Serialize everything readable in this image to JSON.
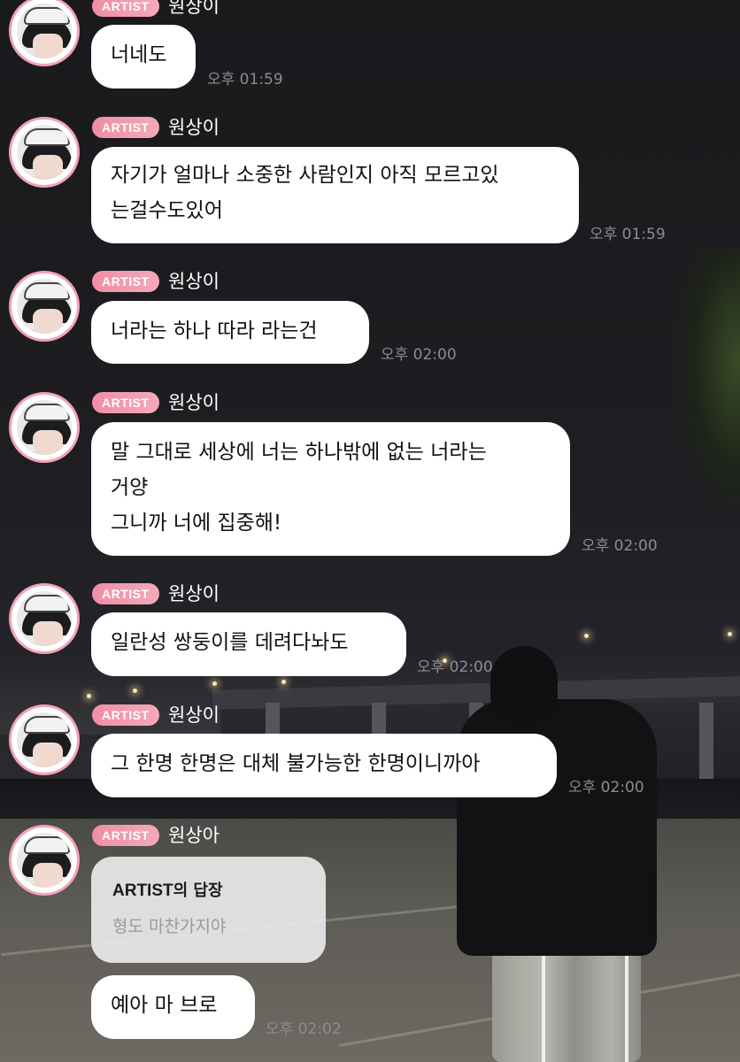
{
  "badge_label": "ARTIST",
  "colors": {
    "badge": "#ef8ea4",
    "avatar_ring": "#f3a2b6",
    "bubble": "#ffffff",
    "timestamp": "#8c8c90"
  },
  "messages": [
    {
      "name": "원상이",
      "text": "너네도",
      "time": "오후 01:59"
    },
    {
      "name": "원상이",
      "text": "자기가 얼마나 소중한 사람인지 아직 모르고있\n는걸수도있어",
      "time": "오후 01:59"
    },
    {
      "name": "원상이",
      "text": "너라는 하나 따라 라는건",
      "time": "오후 02:00"
    },
    {
      "name": "원상이",
      "text": "말 그대로 세상에 너는 하나밖에 없는 너라는\n거양\n그니까 너에 집중해!",
      "time": "오후 02:00"
    },
    {
      "name": "원상이",
      "text": "일란성 쌍둥이를 데려다놔도",
      "time": "오후 02:00"
    },
    {
      "name": "원상이",
      "text": "그 한명 한명은 대체 불가능한 한명이니까아",
      "time": "오후 02:00"
    },
    {
      "name": "원상아",
      "text": "예아 마 브로",
      "time": "오후 02:02"
    }
  ],
  "reply": {
    "title_en": "ARTIST",
    "title_ko": "의 답장",
    "text": "형도 마찬가지야"
  }
}
